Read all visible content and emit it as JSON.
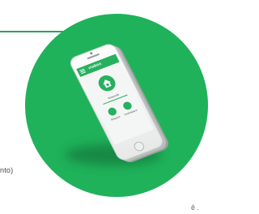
{
  "colors": {
    "circle_green": "#1fb25a",
    "app_green": "#27b05e",
    "rule_green": "#2e9e5e",
    "text_gray": "#4a4a4a"
  },
  "page": {
    "side_text": "nto)",
    "bottom_text": "ê ."
  },
  "phone_app": {
    "brand": "viabox",
    "status_label": "Bloqueado",
    "left_action_label": "Bloquear",
    "right_action_label": "Desbloquear",
    "icons": {
      "menu": "menu-icon",
      "home": "home-lock-icon",
      "left_action": "lock-icon",
      "right_action": "unlock-icon"
    }
  }
}
